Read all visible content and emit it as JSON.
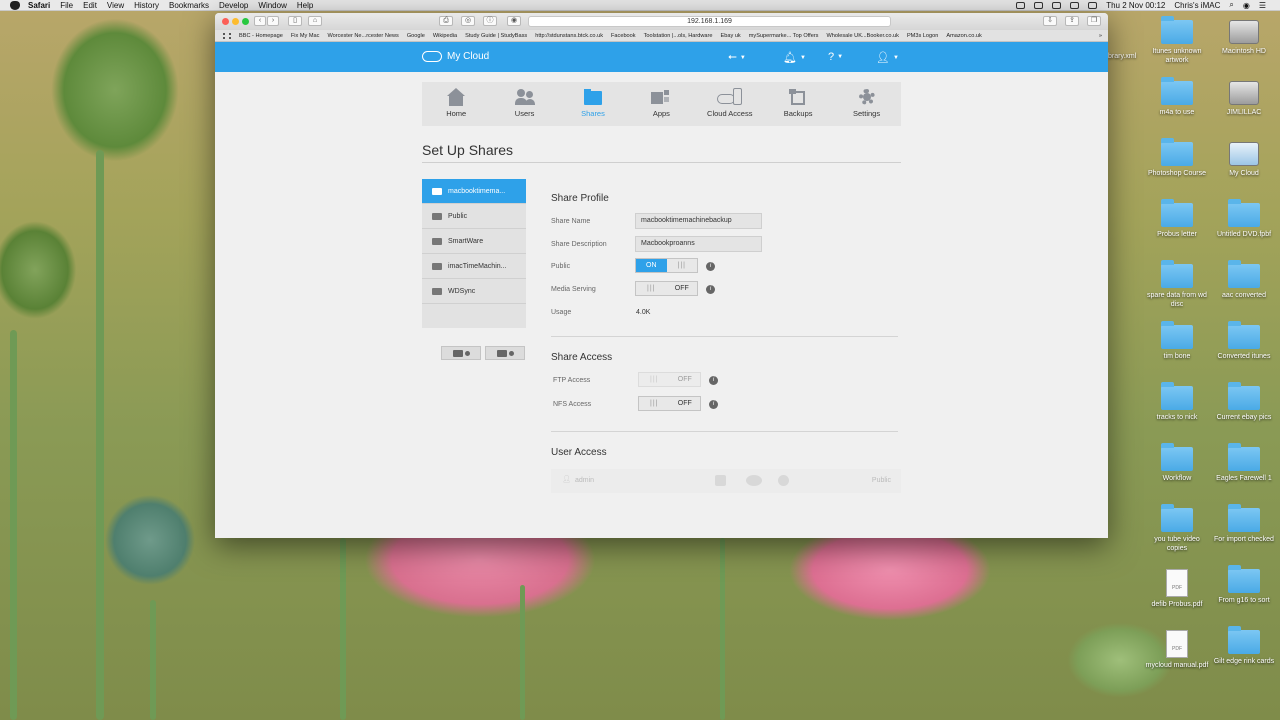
{
  "menubar": {
    "app": "Safari",
    "items": [
      "File",
      "Edit",
      "View",
      "History",
      "Bookmarks",
      "Develop",
      "Window",
      "Help"
    ],
    "clock": "Thu 2 Nov  00:12",
    "user": "Chris's iMAC"
  },
  "browser": {
    "url": "192.168.1.169",
    "favorites": [
      "BBC - Homepage",
      "Fix My Mac",
      "Worcester Ne...rcester News",
      "Google",
      "Wikipedia",
      "Study Guide | StudyBass",
      "http://stdunstans.btck.co.uk",
      "Facebook",
      "Toolstation |...ols, Hardware",
      "Ebay uk",
      "mySupermarke... Top Offers",
      "Wholesale UK...Booker.co.uk",
      "PM3s Logon",
      "Amazon.co.uk"
    ],
    "more": "»"
  },
  "app": {
    "logo": "My Cloud",
    "nav": [
      {
        "label": "Home"
      },
      {
        "label": "Users"
      },
      {
        "label": "Shares"
      },
      {
        "label": "Apps"
      },
      {
        "label": "Cloud Access"
      },
      {
        "label": "Backups"
      },
      {
        "label": "Settings"
      }
    ],
    "page_title": "Set Up Shares",
    "shares": [
      "macbooktimema...",
      "Public",
      "SmartWare",
      "imacTimeMachin...",
      "WDSync"
    ],
    "profile": {
      "title": "Share Profile",
      "share_name_label": "Share Name",
      "share_name_value": "macbooktimemachinebackup",
      "share_desc_label": "Share Description",
      "share_desc_value": "Macbookproanns",
      "public_label": "Public",
      "public_value": "ON",
      "media_label": "Media Serving",
      "media_value": "OFF",
      "usage_label": "Usage",
      "usage_value": "4.0K"
    },
    "access": {
      "title": "Share Access",
      "ftp_label": "FTP Access",
      "ftp_value": "OFF",
      "nfs_label": "NFS Access",
      "nfs_value": "OFF"
    },
    "user_access": {
      "title": "User Access",
      "user": "admin",
      "access": "Public"
    }
  },
  "desktop": {
    "partial_label": "brary.xml",
    "icons": [
      {
        "label": "Itunes unknown artwork",
        "type": "folder"
      },
      {
        "label": "Macintosh HD",
        "type": "drive"
      },
      {
        "label": "m4a to use",
        "type": "folder"
      },
      {
        "label": "JIMLILLAC",
        "type": "drive"
      },
      {
        "label": "Photoshop Course",
        "type": "folder"
      },
      {
        "label": "My Cloud",
        "type": "app"
      },
      {
        "label": "Probus letter",
        "type": "folder"
      },
      {
        "label": "Untitled DVD.fpbf",
        "type": "folder"
      },
      {
        "label": "spare data from wd disc",
        "type": "folder"
      },
      {
        "label": "aac converted",
        "type": "folder"
      },
      {
        "label": "tim bone",
        "type": "folder"
      },
      {
        "label": "Converted itunes",
        "type": "folder"
      },
      {
        "label": "tracks to nick",
        "type": "folder"
      },
      {
        "label": "Current ebay pics",
        "type": "folder"
      },
      {
        "label": "Workflow",
        "type": "folder"
      },
      {
        "label": "Eagles Farewell 1",
        "type": "folder"
      },
      {
        "label": "you tube video copies",
        "type": "folder"
      },
      {
        "label": "For import checked",
        "type": "folder"
      },
      {
        "label": "defib Probus.pdf",
        "type": "pdf"
      },
      {
        "label": "From g16 to sort",
        "type": "folder"
      },
      {
        "label": "mycloud manual.pdf",
        "type": "pdf"
      },
      {
        "label": "Gilt edge rink cards",
        "type": "folder"
      }
    ],
    "pdf_tag": "PDF"
  }
}
